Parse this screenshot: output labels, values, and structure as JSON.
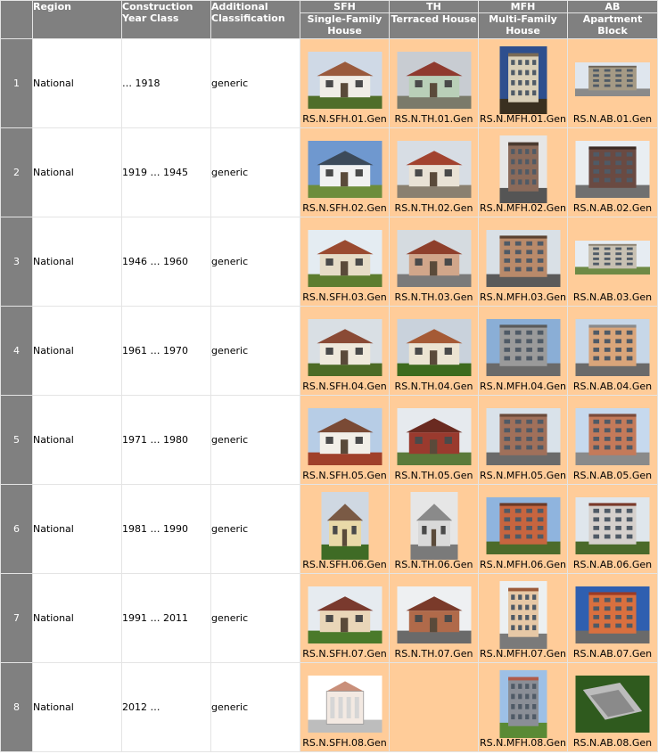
{
  "header": {
    "region": "Region",
    "construction_year_class": "Construction Year Class",
    "additional_classification": "Additional Classification",
    "types": [
      {
        "code": "SFH",
        "name": "Single-Family House"
      },
      {
        "code": "TH",
        "name": "Terraced House"
      },
      {
        "code": "MFH",
        "name": "Multi-Family House"
      },
      {
        "code": "AB",
        "name": "Apartment Block"
      }
    ]
  },
  "colors": {
    "header_bg": "#808080",
    "image_cell_bg": "#ffcc99",
    "grid": "#e4e4e4"
  },
  "rows": [
    {
      "num": "1",
      "region": "National",
      "year_class": "… 1918",
      "classification": "generic",
      "images": [
        {
          "caption": "RS.N.SFH.01.Gen",
          "icon": "house-photo",
          "sky": "#cfd9e6",
          "wall": "#f0ede6",
          "roof": "#9a5a3c",
          "ground": "#4f6e2a",
          "shape": "land"
        },
        {
          "caption": "RS.N.TH.01.Gen",
          "icon": "house-photo",
          "sky": "#c8ccd2",
          "wall": "#b9cfb8",
          "roof": "#8f3a2e",
          "ground": "#7a7a6a",
          "shape": "land"
        },
        {
          "caption": "RS.N.MFH.01.Gen",
          "icon": "building-photo",
          "sky": "#2e4f8e",
          "wall": "#d9cfb8",
          "roof": "#7a6a55",
          "ground": "#3a3020",
          "shape": "port"
        },
        {
          "caption": "RS.N.AB.01.Gen",
          "icon": "building-photo",
          "sky": "#dfe6ee",
          "wall": "#a59a85",
          "roof": "#6c6458",
          "ground": "#8a8a8a",
          "shape": "wide"
        }
      ]
    },
    {
      "num": "2",
      "region": "National",
      "year_class": "1919 … 1945",
      "classification": "generic",
      "images": [
        {
          "caption": "RS.N.SFH.02.Gen",
          "icon": "house-photo",
          "sky": "#6f98cf",
          "wall": "#f1f1f1",
          "roof": "#3c4a5a",
          "ground": "#6d8d3b",
          "shape": "land"
        },
        {
          "caption": "RS.N.TH.02.Gen",
          "icon": "house-photo",
          "sky": "#d7dde4",
          "wall": "#e9e2d5",
          "roof": "#a2432f",
          "ground": "#8a8070",
          "shape": "land"
        },
        {
          "caption": "RS.N.MFH.02.Gen",
          "icon": "building-photo",
          "sky": "#e6e6e6",
          "wall": "#8a6a5a",
          "roof": "#4a3a30",
          "ground": "#555555",
          "shape": "port"
        },
        {
          "caption": "RS.N.AB.02.Gen",
          "icon": "building-photo",
          "sky": "#e9eef2",
          "wall": "#6a4a42",
          "roof": "#3a2a25",
          "ground": "#707070",
          "shape": "land"
        }
      ]
    },
    {
      "num": "3",
      "region": "National",
      "year_class": "1946 … 1960",
      "classification": "generic",
      "images": [
        {
          "caption": "RS.N.SFH.03.Gen",
          "icon": "house-photo",
          "sky": "#e4ecf2",
          "wall": "#e6dcc7",
          "roof": "#9a4a30",
          "ground": "#5c7d30",
          "shape": "land"
        },
        {
          "caption": "RS.N.TH.03.Gen",
          "icon": "house-photo",
          "sky": "#d5dbe0",
          "wall": "#d1a68a",
          "roof": "#8e3f2b",
          "ground": "#7a7a7a",
          "shape": "land"
        },
        {
          "caption": "RS.N.MFH.03.Gen",
          "icon": "building-photo",
          "sky": "#d9e0e6",
          "wall": "#b98a6a",
          "roof": "#5a4030",
          "ground": "#5a5a5a",
          "shape": "land"
        },
        {
          "caption": "RS.N.AB.03.Gen",
          "icon": "building-photo",
          "sky": "#e6ecf2",
          "wall": "#c7c0b2",
          "roof": "#8a8070",
          "ground": "#6e8a45",
          "shape": "wide"
        }
      ]
    },
    {
      "num": "4",
      "region": "National",
      "year_class": "1961 … 1970",
      "classification": "generic",
      "images": [
        {
          "caption": "RS.N.SFH.04.Gen",
          "icon": "house-photo",
          "sky": "#d9dfe4",
          "wall": "#efe9dc",
          "roof": "#8a4a35",
          "ground": "#4c6b26",
          "shape": "land"
        },
        {
          "caption": "RS.N.TH.04.Gen",
          "icon": "house-photo",
          "sky": "#c9d2dc",
          "wall": "#ece4d2",
          "roof": "#a55a35",
          "ground": "#3d6b1e",
          "shape": "land"
        },
        {
          "caption": "RS.N.MFH.04.Gen",
          "icon": "building-photo",
          "sky": "#8aaed6",
          "wall": "#9a9a9a",
          "roof": "#5a5a5a",
          "ground": "#6a6a6a",
          "shape": "land"
        },
        {
          "caption": "RS.N.AB.04.Gen",
          "icon": "building-photo",
          "sky": "#c7d7e8",
          "wall": "#d9a57a",
          "roof": "#8a8a8a",
          "ground": "#6a6a6a",
          "shape": "land"
        }
      ]
    },
    {
      "num": "5",
      "region": "National",
      "year_class": "1971 … 1980",
      "classification": "generic",
      "images": [
        {
          "caption": "RS.N.SFH.05.Gen",
          "icon": "house-photo",
          "sky": "#b7cde6",
          "wall": "#f2efe8",
          "roof": "#7a4a35",
          "ground": "#a0402a",
          "shape": "land"
        },
        {
          "caption": "RS.N.TH.05.Gen",
          "icon": "house-photo",
          "sky": "#e6eaee",
          "wall": "#9a3a2e",
          "roof": "#6a2a20",
          "ground": "#5a7a3a",
          "shape": "land"
        },
        {
          "caption": "RS.N.MFH.05.Gen",
          "icon": "building-photo",
          "sky": "#d9e2ea",
          "wall": "#a0705a",
          "roof": "#6a4a3a",
          "ground": "#6a6a6a",
          "shape": "land"
        },
        {
          "caption": "RS.N.AB.05.Gen",
          "icon": "building-photo",
          "sky": "#c6d9ee",
          "wall": "#c47a5a",
          "roof": "#7a4a3a",
          "ground": "#8a8a8a",
          "shape": "land"
        }
      ]
    },
    {
      "num": "6",
      "region": "National",
      "year_class": "1981 … 1990",
      "classification": "generic",
      "images": [
        {
          "caption": "RS.N.SFH.06.Gen",
          "icon": "house-photo",
          "sky": "#cfd8e2",
          "wall": "#e9d9a8",
          "roof": "#7a5a45",
          "ground": "#3f6b25",
          "shape": "port"
        },
        {
          "caption": "RS.N.TH.06.Gen",
          "icon": "house-photo",
          "sky": "#e6e6e6",
          "wall": "#d9d9d9",
          "roof": "#8a8a8a",
          "ground": "#7a7a7a",
          "shape": "port"
        },
        {
          "caption": "RS.N.MFH.06.Gen",
          "icon": "building-photo",
          "sky": "#8fb4de",
          "wall": "#c7653f",
          "roof": "#6a3a28",
          "ground": "#4c6b2a",
          "shape": "land"
        },
        {
          "caption": "RS.N.AB.06.Gen",
          "icon": "building-photo",
          "sky": "#dfe6ec",
          "wall": "#d5d0cc",
          "roof": "#7a3a2a",
          "ground": "#4a6a2a",
          "shape": "land"
        }
      ]
    },
    {
      "num": "7",
      "region": "National",
      "year_class": "1991 … 2011",
      "classification": "generic",
      "images": [
        {
          "caption": "RS.N.SFH.07.Gen",
          "icon": "house-photo",
          "sky": "#e6ebf0",
          "wall": "#e9d6b8",
          "roof": "#7a3a2e",
          "ground": "#4a7a2a",
          "shape": "land"
        },
        {
          "caption": "RS.N.TH.07.Gen",
          "icon": "house-photo",
          "sky": "#eef0f2",
          "wall": "#b06a4a",
          "roof": "#7a3a2a",
          "ground": "#6a6a6a",
          "shape": "land"
        },
        {
          "caption": "RS.N.MFH.07.Gen",
          "icon": "building-photo",
          "sky": "#ecf0f2",
          "wall": "#e6c8a6",
          "roof": "#9a5a3a",
          "ground": "#7a7a7a",
          "shape": "port"
        },
        {
          "caption": "RS.N.AB.07.Gen",
          "icon": "building-photo",
          "sky": "#2f5fb0",
          "wall": "#d9703f",
          "roof": "#9a3a25",
          "ground": "#6a6a6a",
          "shape": "land"
        }
      ]
    },
    {
      "num": "8",
      "region": "National",
      "year_class": "2012 …",
      "classification": "generic",
      "images": [
        {
          "caption": "RS.N.SFH.08.Gen",
          "icon": "drawing-photo",
          "sky": "#ffffff",
          "wall": "#f3e9e2",
          "roof": "#c98f7a",
          "ground": "#bdbdbd",
          "shape": "land"
        },
        null,
        {
          "caption": "RS.N.MFH.08.Gen",
          "icon": "building-photo",
          "sky": "#9dc0e6",
          "wall": "#8a8e96",
          "roof": "#b05a4a",
          "ground": "#5a8a35",
          "shape": "port"
        },
        {
          "caption": "RS.N.AB.08.Gen",
          "icon": "aerial-photo",
          "sky": "#3f6a2a",
          "wall": "#bcbcbc",
          "roof": "#8a8a8a",
          "ground": "#2f5a1e",
          "shape": "land"
        }
      ]
    }
  ]
}
